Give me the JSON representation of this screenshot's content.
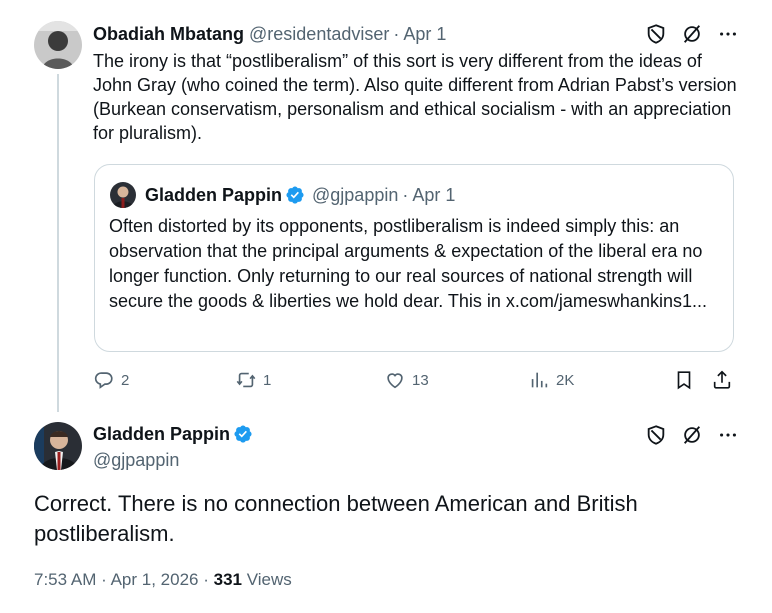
{
  "reply": {
    "author_name": "Obadiah Mbatang",
    "author_handle": "@residentadviser",
    "separator": "·",
    "date": "Apr 1",
    "text": "The irony is that “postliberalism” of this sort is very different from the ideas of John Gray (who coined the term). Also quite different from Adrian Pabst’s version (Burkean conservatism, personalism and ethical socialism - with an appreciation for pluralism).",
    "quote": {
      "author_name": "Gladden Pappin",
      "author_handle": "@gjpappin",
      "separator": "·",
      "date": "Apr 1",
      "text": "Often distorted by its opponents, postliberalism is indeed simply this: an observation that the principal arguments & expectation of the liberal era no longer function. Only returning to our real sources of national strength will secure the goods & liberties we hold dear. This in x.com/jameswhankins1..."
    },
    "actions": {
      "replies": "2",
      "reposts": "1",
      "likes": "13",
      "views": "2K"
    }
  },
  "main_post": {
    "author_name": "Gladden Pappin",
    "author_handle": "@gjpappin",
    "text": "Correct. There is no connection between American and British postliberalism.",
    "time": "7:53 AM",
    "separator": "·",
    "date": "Apr 1, 2026",
    "views_count": "331",
    "views_label": "Views"
  },
  "icons": {
    "verified": "verified-badge-icon",
    "shield": "shield-icon",
    "hide": "slash-circle-icon",
    "more": "more-icon",
    "reply": "reply-icon",
    "repost": "repost-icon",
    "like": "heart-icon",
    "views": "analytics-icon",
    "bookmark": "bookmark-icon",
    "share": "share-icon"
  },
  "colors": {
    "verified": "#1d9bf0",
    "secondary_text": "#536471",
    "primary_text": "#0f1419",
    "border": "#cfd9de"
  }
}
